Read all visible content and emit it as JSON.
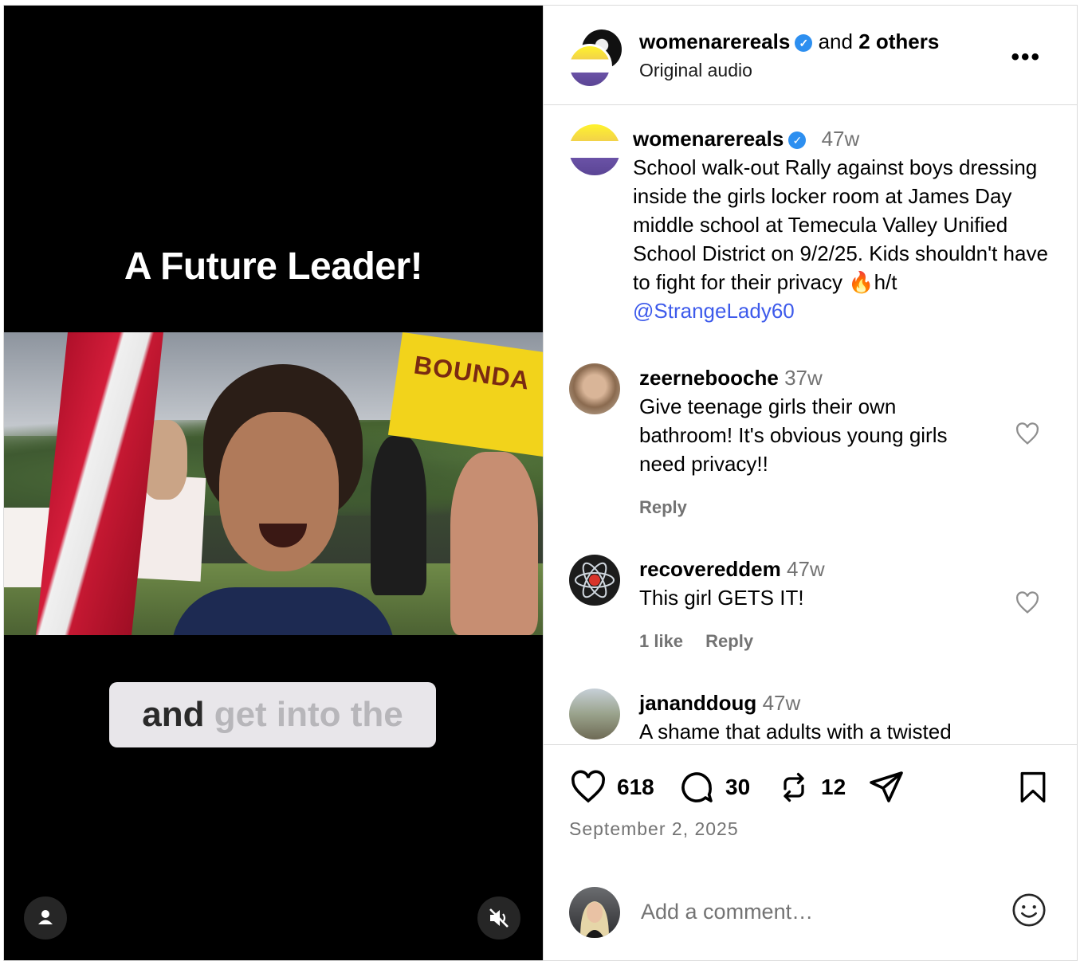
{
  "video": {
    "title": "A Future Leader!",
    "caption_spoken": "and",
    "caption_upcoming": "get into the",
    "sign_text": "BOUNDA"
  },
  "header": {
    "username": "womenarereals",
    "and_text": "and",
    "others_text": "2 others",
    "audio": "Original audio"
  },
  "post": {
    "username": "womenarereals",
    "time": "47w",
    "text": "School walk-out Rally against boys dressing inside the girls locker room at James Day middle school at Temecula Valley Unified School District on 9/2/25. Kids shouldn't have to fight for their privacy 🔥h/t",
    "mention": "@StrangeLady60"
  },
  "comments": [
    {
      "username": "zeernebooche",
      "time": "37w",
      "text": "Give teenage girls their own bathroom! It's obvious young girls need privacy!!",
      "likes": "",
      "reply": "Reply"
    },
    {
      "username": "recovereddem",
      "time": "47w",
      "text": "This girl GETS IT!",
      "likes": "1 like",
      "reply": "Reply"
    },
    {
      "username": "jananddoug",
      "time": "47w",
      "text": "A shame that adults with a twisted",
      "likes": "",
      "reply": ""
    }
  ],
  "actions": {
    "likes": "618",
    "comments": "30",
    "reposts": "12"
  },
  "date": "September 2, 2025",
  "add_comment": {
    "placeholder": "Add a comment…"
  },
  "colors": {
    "verified": "#2d8ff0",
    "mention": "#3d5aeb",
    "muted": "#737373",
    "border": "#dbdbdb"
  }
}
